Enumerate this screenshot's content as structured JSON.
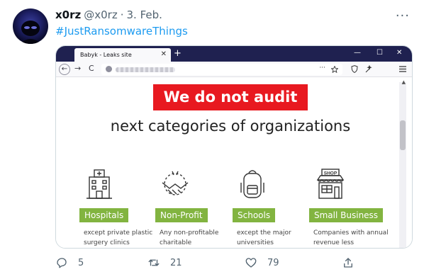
{
  "tweet": {
    "display_name": "x0rz",
    "handle": "@x0rz",
    "separator": "·",
    "date": "3. Feb.",
    "text": "#JustRansomwareThings",
    "more_icon": "more-horizontal-icon"
  },
  "browser": {
    "tab_title": "Babyk - Leaks site",
    "tab_close": "✕",
    "new_tab": "+",
    "controls": {
      "minimize": "—",
      "maximize": "☐",
      "close": "✕"
    },
    "back": "←",
    "forward": "→",
    "reload": "C",
    "page_actions": "···"
  },
  "leak_page": {
    "banner": "We do not audit",
    "subheading": "next categories of organizations",
    "categories": [
      {
        "label": "Hospitals",
        "description": "except private plastic surgery clinics",
        "icon": "hospital-icon"
      },
      {
        "label": "Non-Profit",
        "description": "Any non-profitable charitable",
        "icon": "handshake-icon"
      },
      {
        "label": "Schools",
        "description": "except the major universities",
        "icon": "backpack-icon"
      },
      {
        "label": "Small Business",
        "description": "Companies with annual revenue less",
        "icon": "shop-icon"
      }
    ],
    "shop_sign": "SHOP",
    "colors": {
      "banner": "#e81920",
      "label": "#82b440"
    }
  },
  "actions": {
    "replies": "5",
    "retweets": "21",
    "likes": "79"
  }
}
